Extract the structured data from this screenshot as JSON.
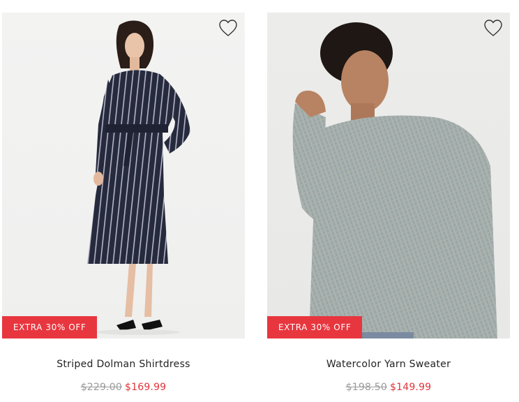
{
  "products": [
    {
      "name": "Striped Dolman Shirtdress",
      "badge": "EXTRA 30% OFF",
      "original_price": "$229.00",
      "sale_price": "$169.99",
      "wishlist_icon": "heart-outline-icon"
    },
    {
      "name": "Watercolor Yarn Sweater",
      "badge": "EXTRA 30% OFF",
      "original_price": "$198.50",
      "sale_price": "$149.99",
      "wishlist_icon": "heart-outline-icon"
    }
  ],
  "colors": {
    "badge_bg": "#e8363f",
    "sale_price": "#e0343b",
    "original_price": "#9a9a9a"
  }
}
